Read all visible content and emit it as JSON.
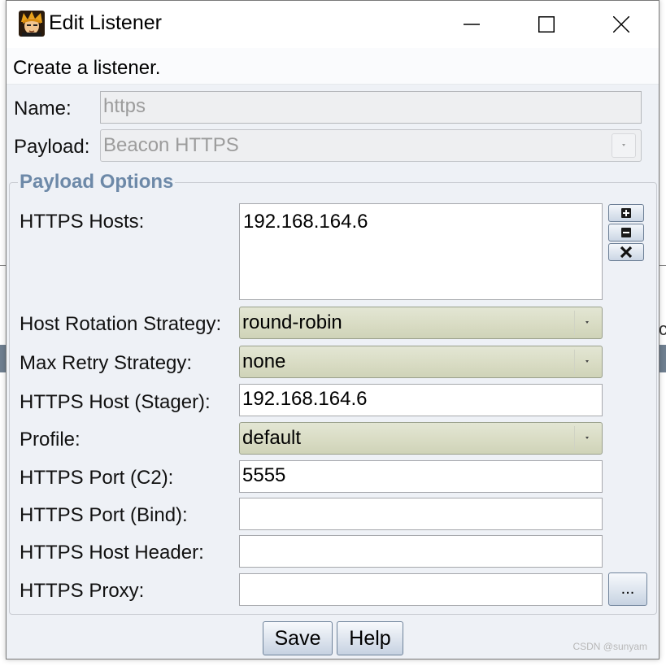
{
  "window": {
    "title": "Edit Listener",
    "controls": {
      "minimize": "minimize",
      "maximize": "maximize",
      "close": "close"
    }
  },
  "header": {
    "text": "Create a listener."
  },
  "form": {
    "name": {
      "label": "Name:",
      "value": "https"
    },
    "payload": {
      "label": "Payload:",
      "value": "Beacon HTTPS"
    }
  },
  "payload_options": {
    "title": "Payload Options",
    "https_hosts": {
      "label": "HTTPS Hosts:",
      "values": [
        "192.168.164.6"
      ]
    },
    "host_rotation": {
      "label": "Host Rotation Strategy:",
      "value": "round-robin"
    },
    "max_retry": {
      "label": "Max Retry Strategy:",
      "value": "none"
    },
    "host_stager": {
      "label": "HTTPS Host (Stager):",
      "value": "192.168.164.6"
    },
    "profile": {
      "label": "Profile:",
      "value": "default"
    },
    "port_c2": {
      "label": "HTTPS Port (C2):",
      "value": "5555"
    },
    "port_bind": {
      "label": "HTTPS Port (Bind):",
      "value": ""
    },
    "host_header": {
      "label": "HTTPS Host Header:",
      "value": ""
    },
    "proxy": {
      "label": "HTTPS Proxy:",
      "value": "",
      "browse_label": "..."
    }
  },
  "buttons": {
    "save": "Save",
    "help": "Help"
  },
  "watermark": "CSDN @sunyam",
  "colors": {
    "group_title": "#6d89a8",
    "combo_bg": "#d9dcc4",
    "button_border": "#6f839b",
    "window_bg": "#eef1f6"
  },
  "icons": {
    "app": "character-avatar-icon",
    "add": "plus-icon",
    "remove": "minus-icon",
    "clear": "x-icon"
  }
}
